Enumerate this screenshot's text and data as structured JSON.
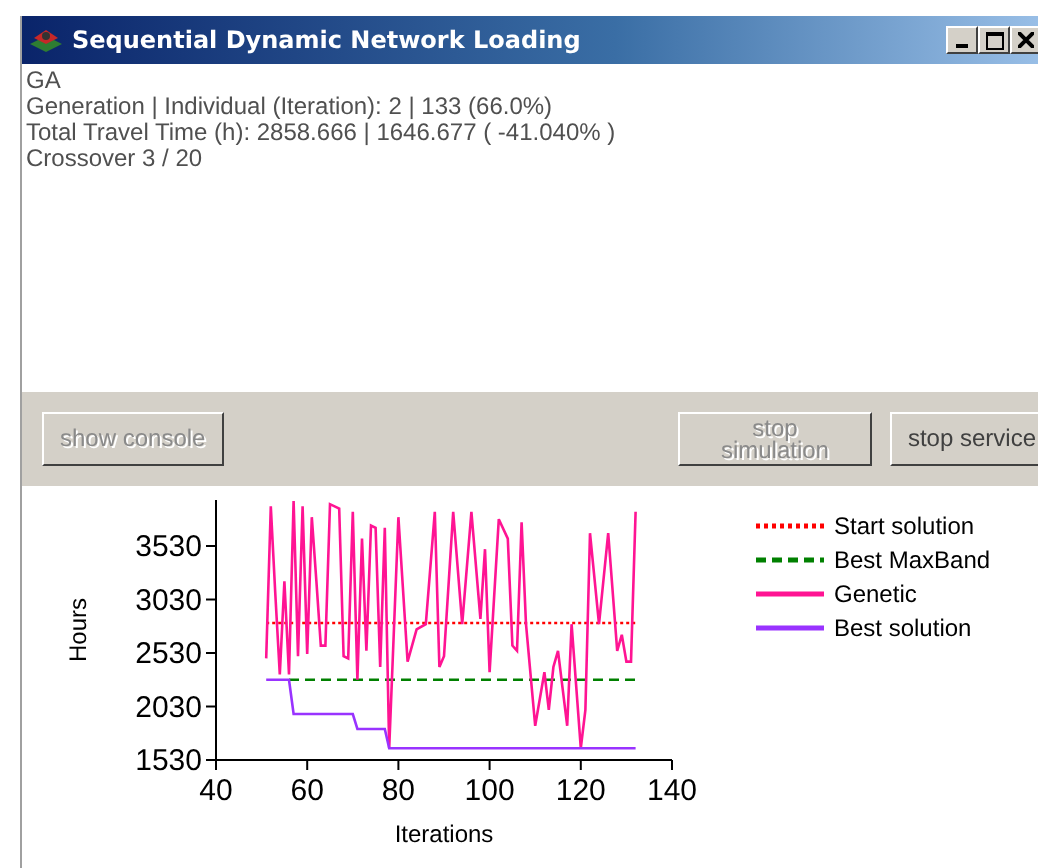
{
  "window": {
    "title": "Sequential Dynamic Network Loading"
  },
  "info_lines": [
    "GA",
    "Generation | Individual (Iteration): 2 | 133 (66.0%)",
    "Total Travel Time (h): 2858.666 | 1646.677 ( -41.040% )",
    "Crossover 3 / 20"
  ],
  "buttons": [
    {
      "label": "show console",
      "disabled": true,
      "kind": "left"
    },
    {
      "label": "stop simulation",
      "disabled": true,
      "kind": "right"
    },
    {
      "label": "stop service",
      "disabled": false,
      "kind": "right"
    }
  ],
  "chart": {
    "chart_data": {
      "type": "line",
      "xlabel": "Iterations",
      "ylabel": "Hours",
      "xlim": [
        40,
        140
      ],
      "ylim": [
        1530,
        3960
      ],
      "xticks": [
        40,
        60,
        80,
        100,
        120,
        140
      ],
      "yticks": [
        1530,
        2030,
        2530,
        3030,
        3530
      ],
      "x": [
        51,
        52,
        53,
        54,
        55,
        56,
        57,
        58,
        59,
        60,
        61,
        62,
        63,
        64,
        65,
        66,
        67,
        68,
        69,
        70,
        71,
        72,
        73,
        74,
        75,
        76,
        77,
        78,
        80,
        82,
        84,
        86,
        88,
        89,
        90,
        92,
        94,
        96,
        98,
        99,
        100,
        102,
        104,
        105,
        106,
        107,
        108,
        110,
        112,
        113,
        114,
        115,
        116,
        117,
        118,
        120,
        121,
        122,
        124,
        126,
        128,
        129,
        130,
        131,
        132
      ],
      "series": [
        {
          "name": "Start solution",
          "color": "#ff0000",
          "line_style": "dotted",
          "values": [
            2810,
            2810,
            2810,
            2810,
            2810,
            2810,
            2810,
            2810,
            2810,
            2810,
            2810,
            2810,
            2810,
            2810,
            2810,
            2810,
            2810,
            2810,
            2810,
            2810,
            2810,
            2810,
            2810,
            2810,
            2810,
            2810,
            2810,
            2810,
            2810,
            2810,
            2810,
            2810,
            2810,
            2810,
            2810,
            2810,
            2810,
            2810,
            2810,
            2810,
            2810,
            2810,
            2810,
            2810,
            2810,
            2810,
            2810,
            2810,
            2810,
            2810,
            2810,
            2810,
            2810,
            2810,
            2810,
            2810,
            2810,
            2810,
            2810,
            2810,
            2810,
            2810,
            2810,
            2810,
            2810
          ]
        },
        {
          "name": "Best MaxBand",
          "color": "#008000",
          "line_style": "dashed",
          "values": [
            null,
            null,
            null,
            null,
            null,
            2280,
            2280,
            2280,
            2280,
            2280,
            2280,
            2280,
            2280,
            2280,
            2280,
            2280,
            2280,
            2280,
            2280,
            2280,
            2280,
            2280,
            2280,
            2280,
            2280,
            2280,
            2280,
            2280,
            2280,
            2280,
            2280,
            2280,
            2280,
            2280,
            2280,
            2280,
            2280,
            2280,
            2280,
            2280,
            2280,
            2280,
            2280,
            2280,
            2280,
            2280,
            2280,
            2280,
            2280,
            2280,
            2280,
            2280,
            2280,
            2280,
            2280,
            2280,
            2280,
            2280,
            2280,
            2280,
            2280,
            2280,
            2280,
            2280,
            2280
          ]
        },
        {
          "name": "Genetic",
          "color": "#ff1493",
          "line_style": "solid",
          "values": [
            2480,
            3900,
            3100,
            2330,
            3200,
            2330,
            3950,
            2500,
            3900,
            2520,
            3800,
            3200,
            2600,
            2600,
            3920,
            3900,
            3880,
            2500,
            2480,
            3850,
            2280,
            3600,
            2550,
            3720,
            3700,
            2400,
            3700,
            1640,
            3800,
            2450,
            2750,
            2800,
            3850,
            2400,
            2500,
            3850,
            2800,
            3850,
            2850,
            3500,
            2350,
            3780,
            3600,
            2600,
            2550,
            3750,
            2800,
            1850,
            2350,
            2000,
            2400,
            2550,
            2200,
            1850,
            2800,
            1640,
            2000,
            3650,
            2800,
            3650,
            2550,
            2700,
            2450,
            2450,
            3850
          ]
        },
        {
          "name": "Best solution",
          "color": "#9933ff",
          "line_style": "solid",
          "values": [
            2280,
            2280,
            2280,
            2280,
            2280,
            2280,
            1960,
            1960,
            1960,
            1960,
            1960,
            1960,
            1960,
            1960,
            1960,
            1960,
            1960,
            1960,
            1960,
            1960,
            1820,
            1820,
            1820,
            1820,
            1820,
            1820,
            1820,
            1640,
            1640,
            1640,
            1640,
            1640,
            1640,
            1640,
            1640,
            1640,
            1640,
            1640,
            1640,
            1640,
            1640,
            1640,
            1640,
            1640,
            1640,
            1640,
            1640,
            1640,
            1640,
            1640,
            1640,
            1640,
            1640,
            1640,
            1640,
            1640,
            1640,
            1640,
            1640,
            1640,
            1640,
            1640,
            1640,
            1640,
            1640
          ]
        }
      ]
    }
  }
}
